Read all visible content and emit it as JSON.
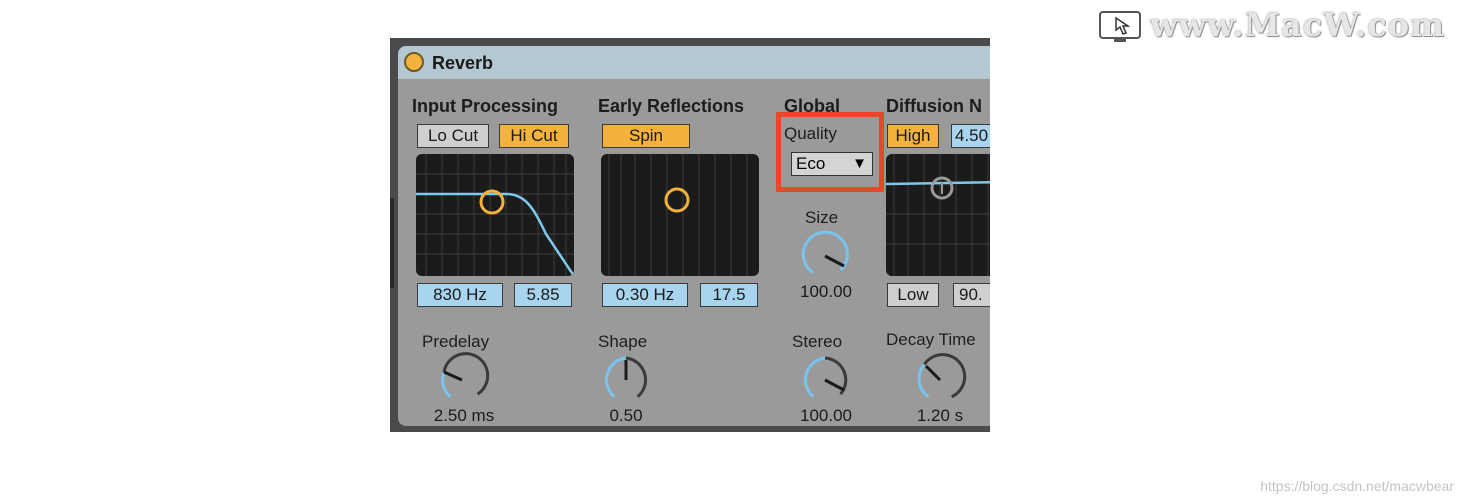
{
  "watermark": {
    "text": "www.MacW.com",
    "credit": "https://blog.csdn.net/macwbear"
  },
  "device": {
    "title": "Reverb"
  },
  "input_processing": {
    "heading": "Input Processing",
    "lo_cut": "Lo Cut",
    "hi_cut": "Hi Cut",
    "freq": "830 Hz",
    "width": "5.85"
  },
  "early_reflections": {
    "heading": "Early Reflections",
    "spin": "Spin",
    "amount": "0.30 Hz",
    "rate": "17.5"
  },
  "global": {
    "heading": "Global",
    "quality_label": "Quality",
    "quality_value": "Eco",
    "size_label": "Size",
    "size_value": "100.00",
    "stereo_label": "Stereo",
    "stereo_value": "100.00"
  },
  "diffusion": {
    "heading": "Diffusion N",
    "high": "High",
    "high_value": "4.50",
    "low": "Low",
    "low_value": "90."
  },
  "knobs": {
    "predelay_label": "Predelay",
    "predelay_value": "2.50 ms",
    "shape_label": "Shape",
    "shape_value": "0.50",
    "decay_label": "Decay Time",
    "decay_value": "1.20 s"
  },
  "colors": {
    "accent": "#f2b23c",
    "blue": "#a8d4ee",
    "highlight": "#e8482a",
    "panel": "#9a9a9a"
  }
}
